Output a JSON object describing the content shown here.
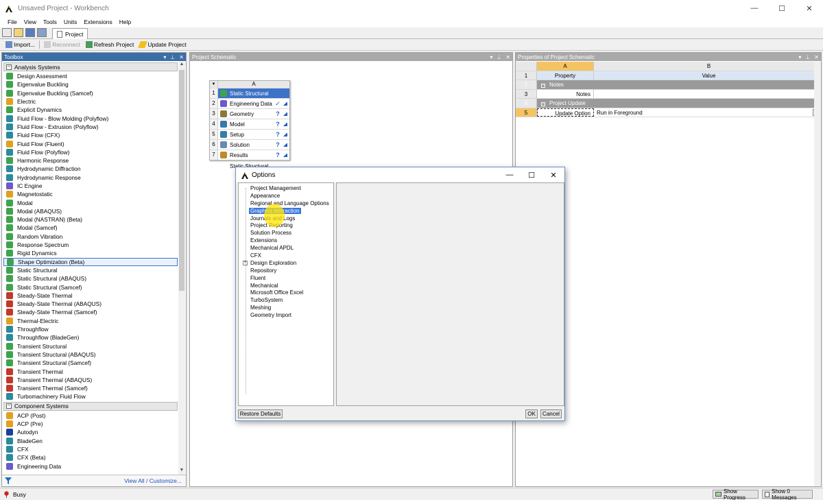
{
  "window": {
    "title": "Unsaved Project - Workbench"
  },
  "window_controls": [
    "—",
    "☐",
    "✕"
  ],
  "menu": [
    "File",
    "View",
    "Tools",
    "Units",
    "Extensions",
    "Help"
  ],
  "tab": {
    "label": "Project"
  },
  "toolbar": {
    "import": "Import...",
    "reconnect": "Reconnect",
    "refresh": "Refresh Project",
    "update": "Update Project"
  },
  "toolbox": {
    "header": "Toolbox",
    "analysis_title": "Analysis Systems",
    "analysis_items": [
      {
        "label": "Design Assessment",
        "color": "#3fa34d"
      },
      {
        "label": "Eigenvalue Buckling",
        "color": "#3fa34d"
      },
      {
        "label": "Eigenvalue Buckling (Samcef)",
        "color": "#3fa34d"
      },
      {
        "label": "Electric",
        "color": "#e2a020"
      },
      {
        "label": "Explicit Dynamics",
        "color": "#3fa34d"
      },
      {
        "label": "Fluid Flow - Blow Molding (Polyflow)",
        "color": "#2b8a9c"
      },
      {
        "label": "Fluid Flow - Extrusion (Polyflow)",
        "color": "#2b8a9c"
      },
      {
        "label": "Fluid Flow (CFX)",
        "color": "#2b8a9c"
      },
      {
        "label": "Fluid Flow (Fluent)",
        "color": "#e2a020"
      },
      {
        "label": "Fluid Flow (Polyflow)",
        "color": "#2b8a9c"
      },
      {
        "label": "Harmonic Response",
        "color": "#3fa34d"
      },
      {
        "label": "Hydrodynamic Diffraction",
        "color": "#2b8a9c"
      },
      {
        "label": "Hydrodynamic Response",
        "color": "#2b8a9c"
      },
      {
        "label": "IC Engine",
        "color": "#6a5acd"
      },
      {
        "label": "Magnetostatic",
        "color": "#e2a020"
      },
      {
        "label": "Modal",
        "color": "#3fa34d"
      },
      {
        "label": "Modal (ABAQUS)",
        "color": "#3fa34d"
      },
      {
        "label": "Modal (NASTRAN) (Beta)",
        "color": "#3fa34d"
      },
      {
        "label": "Modal (Samcef)",
        "color": "#3fa34d"
      },
      {
        "label": "Random Vibration",
        "color": "#3fa34d"
      },
      {
        "label": "Response Spectrum",
        "color": "#3fa34d"
      },
      {
        "label": "Rigid Dynamics",
        "color": "#3fa34d"
      },
      {
        "label": "Shape Optimization (Beta)",
        "color": "#3fa34d",
        "selected": true
      },
      {
        "label": "Static Structural",
        "color": "#3fa34d"
      },
      {
        "label": "Static Structural (ABAQUS)",
        "color": "#3fa34d"
      },
      {
        "label": "Static Structural (Samcef)",
        "color": "#3fa34d"
      },
      {
        "label": "Steady-State Thermal",
        "color": "#c0392b"
      },
      {
        "label": "Steady-State Thermal (ABAQUS)",
        "color": "#c0392b"
      },
      {
        "label": "Steady-State Thermal (Samcef)",
        "color": "#c0392b"
      },
      {
        "label": "Thermal-Electric",
        "color": "#e2a020"
      },
      {
        "label": "Throughflow",
        "color": "#2b8a9c"
      },
      {
        "label": "Throughflow (BladeGen)",
        "color": "#2b8a9c"
      },
      {
        "label": "Transient Structural",
        "color": "#3fa34d"
      },
      {
        "label": "Transient Structural (ABAQUS)",
        "color": "#3fa34d"
      },
      {
        "label": "Transient Structural (Samcef)",
        "color": "#3fa34d"
      },
      {
        "label": "Transient Thermal",
        "color": "#c0392b"
      },
      {
        "label": "Transient Thermal (ABAQUS)",
        "color": "#c0392b"
      },
      {
        "label": "Transient Thermal (Samcef)",
        "color": "#c0392b"
      },
      {
        "label": "Turbomachinery Fluid Flow",
        "color": "#2b8a9c"
      }
    ],
    "component_title": "Component Systems",
    "component_items": [
      {
        "label": "ACP (Post)",
        "color": "#e2a020"
      },
      {
        "label": "ACP (Pre)",
        "color": "#e2a020"
      },
      {
        "label": "Autodyn",
        "color": "#1f3f9c"
      },
      {
        "label": "BladeGen",
        "color": "#2b8a9c"
      },
      {
        "label": "CFX",
        "color": "#2b8a9c"
      },
      {
        "label": "CFX (Beta)",
        "color": "#2b8a9c"
      },
      {
        "label": "Engineering Data",
        "color": "#6a5acd"
      }
    ],
    "view_all": "View All / Customize..."
  },
  "schematic": {
    "header": "Project Schematic",
    "column": "A",
    "rows": [
      {
        "num": "1",
        "label": "Static Structural",
        "color": "#3fa34d",
        "status": ""
      },
      {
        "num": "2",
        "label": "Engineering Data",
        "color": "#6a5acd",
        "status": "✓"
      },
      {
        "num": "3",
        "label": "Geometry",
        "color": "#8a7a3a",
        "status": "?"
      },
      {
        "num": "4",
        "label": "Model",
        "color": "#3a7aa8",
        "status": "?"
      },
      {
        "num": "5",
        "label": "Setup",
        "color": "#3a7aa8",
        "status": "?"
      },
      {
        "num": "6",
        "label": "Solution",
        "color": "#6a8ab0",
        "status": "?"
      },
      {
        "num": "7",
        "label": "Results",
        "color": "#c08a2a",
        "status": "?"
      }
    ],
    "caption": "Static Structural"
  },
  "properties": {
    "header": "Properties of Project Schematic",
    "col_a": "A",
    "col_b": "B",
    "rows": [
      {
        "num": "1",
        "a": "Property",
        "b": "Value",
        "kind": "hdr"
      },
      {
        "num": "2",
        "a": "Notes",
        "b": "",
        "kind": "grp"
      },
      {
        "num": "3",
        "a": "Notes",
        "b": "",
        "kind": "plain"
      },
      {
        "num": "4",
        "a": "Project Update",
        "b": "",
        "kind": "grp"
      },
      {
        "num": "5",
        "a": "Update Option",
        "b": "Run in Foreground",
        "kind": "sel"
      }
    ]
  },
  "dialog": {
    "title": "Options",
    "tree": [
      {
        "label": "Project Management"
      },
      {
        "label": "Appearance"
      },
      {
        "label": "Regional and Language Options"
      },
      {
        "label": "Graphics Interaction",
        "selected": true
      },
      {
        "label": "Journals and Logs"
      },
      {
        "label": "Project Reporting"
      },
      {
        "label": "Solution Process"
      },
      {
        "label": "Extensions"
      },
      {
        "label": "Mechanical APDL"
      },
      {
        "label": "CFX"
      },
      {
        "label": "Design Exploration",
        "expandable": true
      },
      {
        "label": "Repository"
      },
      {
        "label": "Fluent"
      },
      {
        "label": "Mechanical"
      },
      {
        "label": "Microsoft Office Excel"
      },
      {
        "label": "TurboSystem"
      },
      {
        "label": "Meshing"
      },
      {
        "label": "Geometry Import"
      }
    ],
    "restore": "Restore Defaults",
    "ok": "OK",
    "cancel": "Cancel"
  },
  "status": {
    "text": "Busy",
    "progress": "Show Progress",
    "messages": "Show 0 Messages"
  },
  "icons": {
    "app": "ansys-logo-icon",
    "pin": "pin-icon",
    "close": "close-icon",
    "filter": "filter-icon"
  }
}
